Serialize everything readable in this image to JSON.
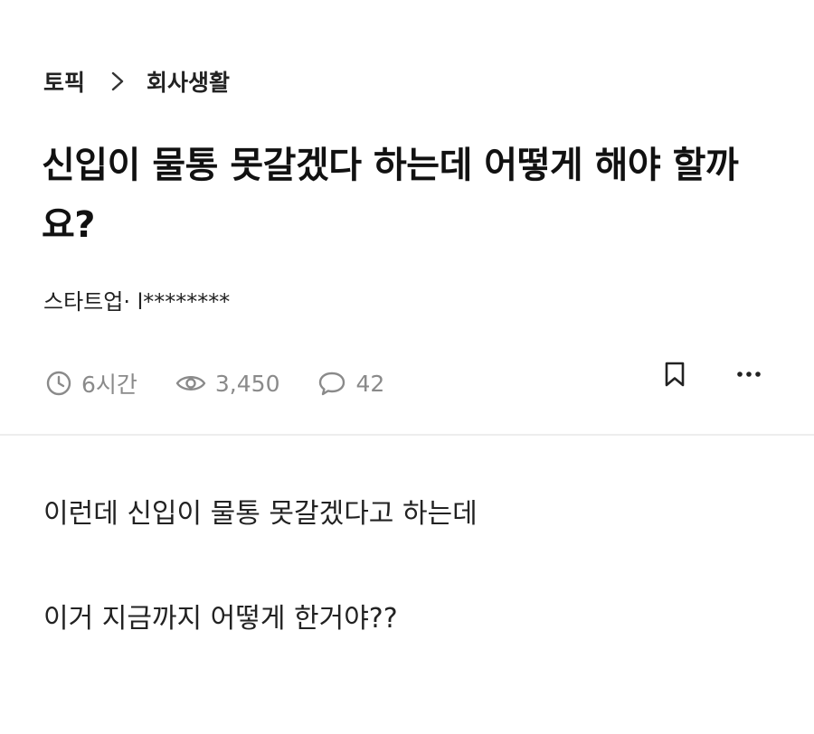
{
  "breadcrumb": {
    "root": "토픽",
    "current": "회사생활"
  },
  "post": {
    "title": "신입이 물통 못갈겠다 하는데 어떻게 해야 할까요?",
    "author": "스타트업· l********",
    "time": "6시간",
    "views": "3,450",
    "comments": "42",
    "body": [
      "이런데 신입이 물통 못갈겠다고 하는데",
      "이거 지금까지 어떻게 한거야??"
    ]
  },
  "icons": {
    "separator": "chevron-right-icon",
    "time": "clock-icon",
    "views": "eye-icon",
    "comments": "comment-icon",
    "bookmark": "bookmark-icon",
    "more": "more-icon"
  },
  "colors": {
    "text": "#111111",
    "meta": "#8a8a8a",
    "divider": "#ededed"
  }
}
